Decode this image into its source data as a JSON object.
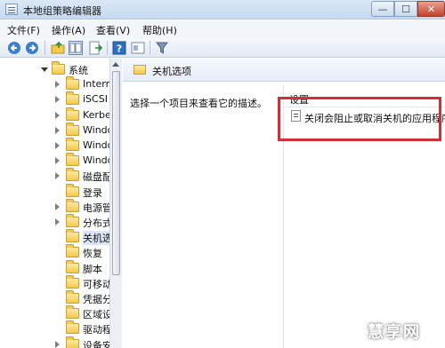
{
  "window": {
    "title": "本地组策略编辑器",
    "min_glyph": "—",
    "max_glyph": "☐",
    "close_glyph": "✕"
  },
  "menu": {
    "items": [
      "文件(F)",
      "操作(A)",
      "查看(V)",
      "帮助(H)"
    ]
  },
  "toolbar": {
    "icons": [
      "back-icon",
      "forward-icon",
      "up-folder-icon",
      "show-hide-tree-icon",
      "export-list-icon",
      "help-icon",
      "properties-icon",
      "filter-icon"
    ]
  },
  "tree": {
    "items": [
      {
        "label": "系统",
        "expanded": true,
        "selected": false
      },
      {
        "label": "Intern",
        "expanded": false,
        "selected": false
      },
      {
        "label": "iSCSI",
        "expanded": false,
        "selected": false
      },
      {
        "label": "Kerbe",
        "expanded": false,
        "selected": false
      },
      {
        "label": "Windo",
        "expanded": false,
        "selected": false
      },
      {
        "label": "Windo",
        "expanded": false,
        "selected": false
      },
      {
        "label": "Windo",
        "expanded": false,
        "selected": false
      },
      {
        "label": "磁盘配",
        "expanded": false,
        "selected": false
      },
      {
        "label": "登录",
        "expanded": false,
        "selected": false
      },
      {
        "label": "电源管",
        "expanded": false,
        "selected": false
      },
      {
        "label": "分布式",
        "expanded": false,
        "selected": false
      },
      {
        "label": "关机选",
        "expanded": false,
        "selected": true
      },
      {
        "label": "恢复",
        "expanded": false,
        "selected": false
      },
      {
        "label": "脚本",
        "expanded": false,
        "selected": false
      },
      {
        "label": "可移动",
        "expanded": false,
        "selected": false
      },
      {
        "label": "凭据分",
        "expanded": false,
        "selected": false
      },
      {
        "label": "区域设",
        "expanded": false,
        "selected": false
      },
      {
        "label": "驱动程",
        "expanded": false,
        "selected": false
      },
      {
        "label": "设备安",
        "expanded": false,
        "selected": false
      }
    ]
  },
  "right": {
    "header_title": "关机选项",
    "description": "选择一个项目来查看它的描述。",
    "column_header": "设置",
    "setting_item": "关闭会阻止或取消关机的应用程序"
  },
  "highlight_color": "#d22f3a",
  "watermark": "慧享网"
}
